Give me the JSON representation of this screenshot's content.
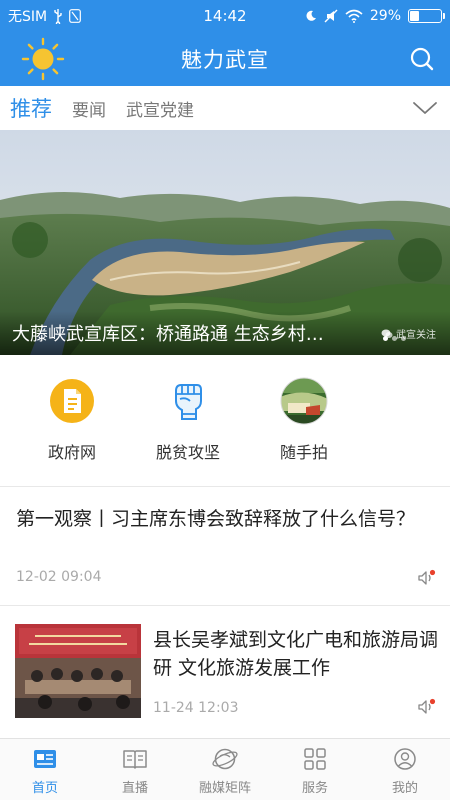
{
  "status_bar": {
    "carrier": "无SIM",
    "time": "14:42",
    "battery_percent": "29%",
    "battery_level": 0.29
  },
  "header": {
    "title": "魅力武宣"
  },
  "tabs": [
    {
      "label": "推荐",
      "active": true
    },
    {
      "label": "要闻",
      "active": false
    },
    {
      "label": "武宣党建",
      "active": false
    }
  ],
  "banner": {
    "caption": "大藤峡武宣库区：桥通路通 生态乡村…",
    "watermark": "武宣关注",
    "dot_count": 3,
    "active_dot": 0
  },
  "quick_links": [
    {
      "label": "政府网",
      "icon": "document-icon"
    },
    {
      "label": "脱贫攻坚",
      "icon": "fist-icon"
    },
    {
      "label": "随手拍",
      "icon": "photo-icon"
    }
  ],
  "news": [
    {
      "title": "第一观察丨习主席东博会致辞释放了什么信号？",
      "time": "12-02 09:04"
    },
    {
      "title": "县长吴孝斌到文化广电和旅游局调研 文化旅游发展工作",
      "time": "11-24 12:03"
    }
  ],
  "bottom_nav": [
    {
      "label": "首页",
      "icon": "home-news-icon",
      "active": true
    },
    {
      "label": "直播",
      "icon": "book-icon",
      "active": false
    },
    {
      "label": "融媒矩阵",
      "icon": "globe-icon",
      "active": false
    },
    {
      "label": "服务",
      "icon": "grid-icon",
      "active": false
    },
    {
      "label": "我的",
      "icon": "user-icon",
      "active": false
    }
  ],
  "colors": {
    "brand": "#2f8fe8",
    "sun": "#f6c431",
    "badge_red": "#e8412c"
  }
}
